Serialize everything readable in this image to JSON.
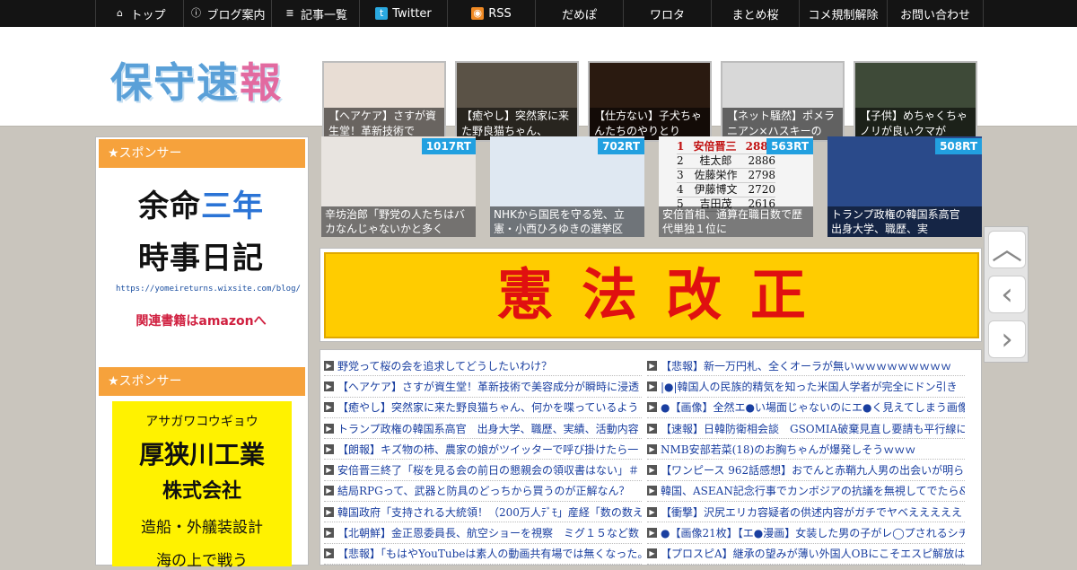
{
  "nav": [
    {
      "icon": "home-icon",
      "glyph": "⌂",
      "label": "トップ",
      "w": 98
    },
    {
      "icon": "info-icon",
      "glyph": "ⓘ",
      "label": "ブログ案内",
      "w": 98
    },
    {
      "icon": "list-icon",
      "glyph": "≣",
      "label": "記事一覧",
      "w": 98
    },
    {
      "icon": "twitter-icon",
      "glyph": "t",
      "label": "Twitter",
      "w": 98
    },
    {
      "icon": "rss-icon",
      "glyph": "◉",
      "label": "RSS",
      "w": 98
    },
    {
      "icon": "",
      "glyph": "",
      "label": "だめぽ",
      "w": 98
    },
    {
      "icon": "",
      "glyph": "",
      "label": "ワロタ",
      "w": 98
    },
    {
      "icon": "",
      "glyph": "",
      "label": "まとめ桜",
      "w": 98
    },
    {
      "icon": "",
      "glyph": "",
      "label": "コメ規制解除",
      "w": 98
    },
    {
      "icon": "",
      "glyph": "",
      "label": "お問い合わせ",
      "w": 108
    }
  ],
  "logo": {
    "part1": "保守",
    "part2": "速",
    "part3": "報"
  },
  "header_thumbs": [
    {
      "caption": "【ヘアケア】さすが資生堂！革新技術で",
      "bg": "#e8ddd4"
    },
    {
      "caption": "【癒やし】突然家に来た野良猫ちゃん、",
      "bg": "#5a5246"
    },
    {
      "caption": "【仕方ない】子犬ちゃんたちのやりとり",
      "bg": "#2a1a10"
    },
    {
      "caption": "【ネット騒然】ポメラニアン×ハスキーの",
      "bg": "#d8d8d8"
    },
    {
      "caption": "【子供】めちゃくちゃノリが良いクマが",
      "bg": "#3e4a38"
    }
  ],
  "sidebar": {
    "sponsor1": "★スポンサー",
    "book1": {
      "l1a": "余命",
      "l1b": "三年",
      "l2": "時事日記",
      "url": "https://yomeireturns.wixsite.com/blog/",
      "amazon": "関連書籍はamazonへ"
    },
    "sponsor2": "★スポンサー",
    "book2": {
      "kana": "アサガワコウギョウ",
      "name": "厚狭川工業",
      "corp": "株式会社",
      "desc": "造船・外艤装設計",
      "extra": "海の上で戦う"
    }
  },
  "featured": [
    {
      "rt": "1017RT",
      "caption": "辛坊治郎「野党の人たちはバカなんじゃないかと多く",
      "bg": "#e8e4e0"
    },
    {
      "rt": "702RT",
      "caption": "NHKから国民を守る党、立憲・小西ひろゆきの選挙区",
      "bg": "#dfe8f2"
    },
    {
      "rt": "563RT",
      "caption": "安倍首相、通算在職日数で歴代単独１位に",
      "bg": "#f4f4f4"
    },
    {
      "rt": "508RT",
      "caption": "トランプ政権の韓国系高官　出身大学、職歴、実",
      "bg": "#2a4a8a"
    }
  ],
  "rank_table": [
    {
      "no": "1",
      "name": "安倍晋三",
      "days": "2887"
    },
    {
      "no": "2",
      "name": "桂太郎",
      "days": "2886"
    },
    {
      "no": "3",
      "name": "佐藤栄作",
      "days": "2798"
    },
    {
      "no": "4",
      "name": "伊藤博文",
      "days": "2720"
    },
    {
      "no": "5",
      "name": "吉田茂",
      "days": "2616"
    }
  ],
  "banner_text": "憲法改正",
  "list_left": [
    "野党って桜の会を追求してどうしたいわけ？",
    "【ヘアケア】さすが資生堂！革新技術で美容成分が瞬時に浸透",
    "【癒やし】突然家に来た野良猫ちゃん、何かを喋っているよう",
    "トランプ政権の韓国系高官　出身大学、職歴、実績、活動内容",
    "【朗報】キズ物の柿、農家の娘がツイッターで呼び掛けたら一",
    "安倍晋三終了「桜を見る会の前日の懇親会の領収書はない」＃",
    "結局RPGって、武器と防具のどっちから買うのが正解なん？",
    "韓国政府「支持される大統領！（200万人ﾃﾞﾓ」産経「数の数え",
    "【北朝鮮】金正恩委員長、航空ショーを視察　ミグ１５など数",
    "【悲報】「もはやYouTubeは素人の動画共有場では無くなった。"
  ],
  "list_right": [
    "【悲報】新一万円札、全くオーラが無いｗｗｗｗｗｗｗｗｗ",
    "|●|韓国人の民族的精気を知った米国人学者が完全にドン引き",
    "●【画像】全然エ●い場面じゃないのにエ●く見えてしまう画像",
    "【速報】日韓防衛相会談　GSOMIA破棄見直し要請も平行線に",
    "NMB安部若菜(18)のお胸ちゃんが爆発しそうｗｗｗ",
    "【ワンピース 962話感想】おでんと赤鞘九人男の出会いが明ら",
    "韓国、ASEAN記念行事でカンボジアの抗議を無視してでたら&",
    "【衝撃】沢尻エリカ容疑者の供述内容がガチでヤベえええええ",
    "●【画像21枚】【エ●漫画】女装した男の子がレ◯プされるシチ",
    "【プロスピA】継承の望みが薄い外国人OBにこそエスピ解放は有"
  ]
}
